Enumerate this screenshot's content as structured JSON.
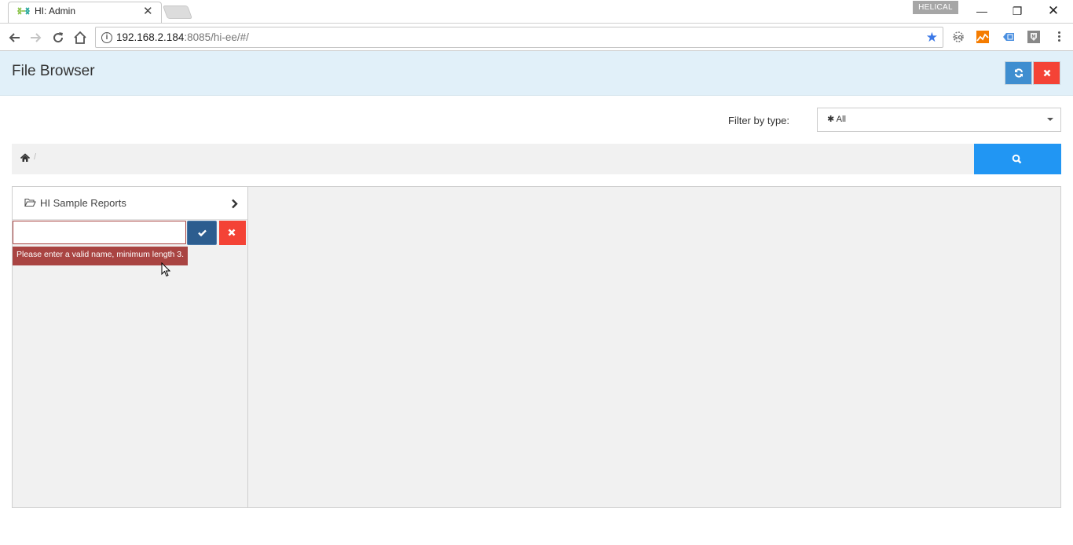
{
  "browser": {
    "tab_title": "HI: Admin",
    "profile_name": "HELICAL",
    "url_host": "192.168.2.184",
    "url_rest": ":8085/hi-ee/#/",
    "icons": [
      "back-icon",
      "forward-icon",
      "reload-icon",
      "home-icon",
      "info-icon",
      "bookmark-star-icon",
      "seo-extension-icon",
      "analytics-extension-icon",
      "tag-extension-icon",
      "shield-extension-icon",
      "menu-dots-icon"
    ]
  },
  "header": {
    "title": "File Browser",
    "refresh_icon": "refresh-icon",
    "close_icon": "close-icon",
    "accent_blue": "#3f8ed0",
    "accent_red": "#f44336"
  },
  "filter": {
    "label": "Filter by type:",
    "selected": "✱ All"
  },
  "breadcrumb": {
    "home_icon": "home-icon",
    "separator": "/"
  },
  "search": {
    "icon": "search-icon",
    "color": "#2196f3"
  },
  "tree": {
    "folder": {
      "label": "HI Sample Reports",
      "icon": "folder-open-icon"
    },
    "new_folder": {
      "value": "",
      "placeholder": "",
      "error": "Please enter a valid name, minimum length 3.",
      "error_color": "#a94442",
      "confirm_icon": "check-icon",
      "cancel_icon": "close-icon"
    }
  }
}
